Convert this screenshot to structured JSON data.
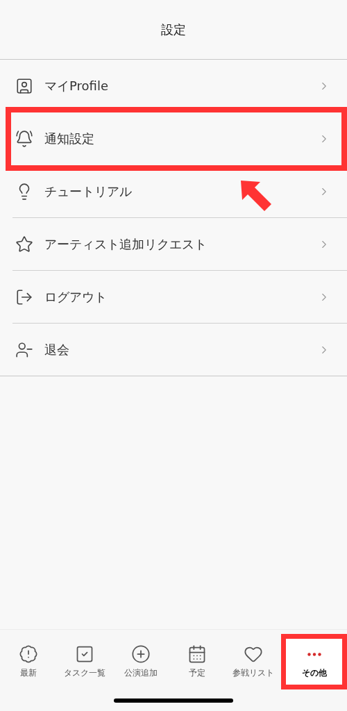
{
  "header": {
    "title": "設定"
  },
  "items": [
    {
      "kind": "profile",
      "label": "マイProfile",
      "highlighted": false
    },
    {
      "kind": "bell",
      "label": "通知設定",
      "highlighted": true
    },
    {
      "kind": "bulb",
      "label": "チュートリアル",
      "highlighted": false
    },
    {
      "kind": "star",
      "label": "アーティスト追加リクエスト",
      "highlighted": false
    },
    {
      "kind": "logout",
      "label": "ログアウト",
      "highlighted": false
    },
    {
      "kind": "leave",
      "label": "退会",
      "highlighted": false
    }
  ],
  "tabs": [
    {
      "kind": "news",
      "label": "最新",
      "selected": false,
      "highlighted": false
    },
    {
      "kind": "tasks",
      "label": "タスク一覧",
      "selected": false,
      "highlighted": false
    },
    {
      "kind": "add",
      "label": "公演追加",
      "selected": false,
      "highlighted": false
    },
    {
      "kind": "schedule",
      "label": "予定",
      "selected": false,
      "highlighted": false
    },
    {
      "kind": "list",
      "label": "参戦リスト",
      "selected": false,
      "highlighted": false
    },
    {
      "kind": "more",
      "label": "その他",
      "selected": true,
      "highlighted": true
    }
  ]
}
